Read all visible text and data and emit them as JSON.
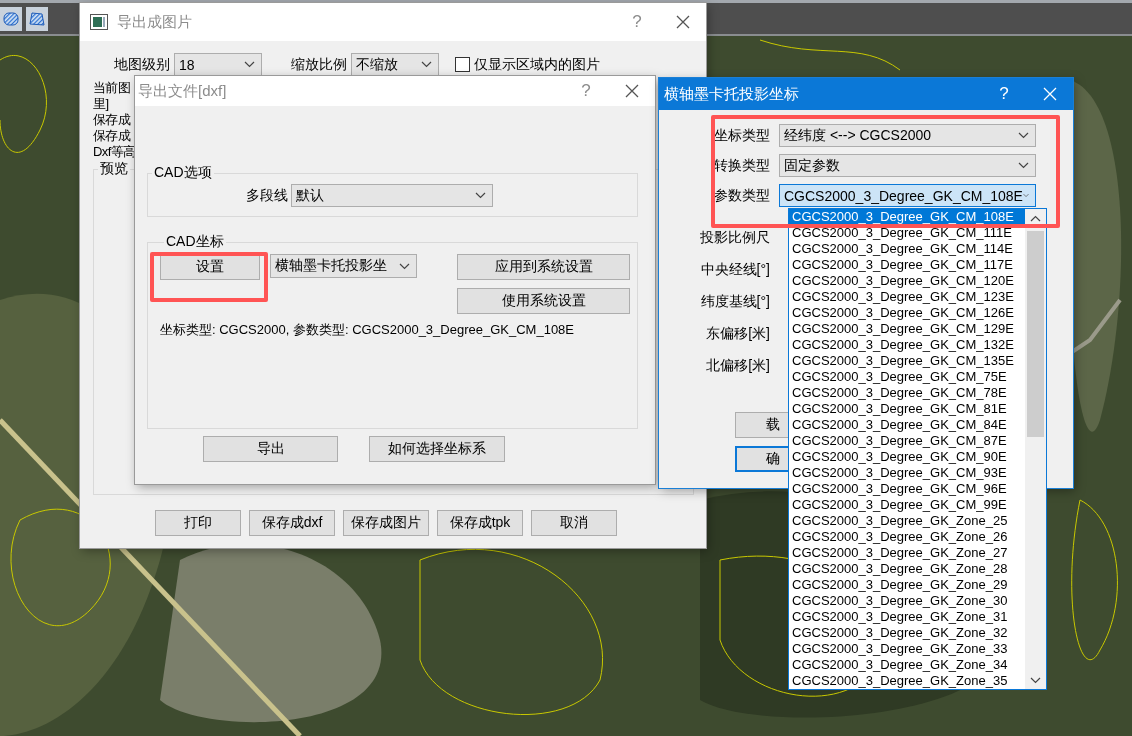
{
  "export_image_dialog": {
    "title": "导出成图片",
    "help": "?",
    "active": false,
    "map_level": {
      "label": "地图级别",
      "value": "18"
    },
    "scale": {
      "label": "缩放比例",
      "value": "不缩放"
    },
    "region_only": {
      "label": "仅显示区域内的图片",
      "checked": false
    },
    "info_lines": [
      "当前图",
      "里]",
      "保存成",
      "保存成",
      "Dxf等高"
    ],
    "preview_group": "预览",
    "buttons": [
      "打印",
      "保存成dxf",
      "保存成图片",
      "保存成tpk",
      "取消"
    ]
  },
  "dxf_dialog": {
    "title": "导出文件[dxf]",
    "help": "?",
    "active": false,
    "cad_options": {
      "title": "CAD选项",
      "polyline": {
        "label": "多段线",
        "value": "默认"
      }
    },
    "cad_coords": {
      "title": "CAD坐标",
      "settings_button": {
        "label": "设置",
        "highlighted": true
      },
      "projection": {
        "value": "横轴墨卡托投影坐"
      },
      "buttons": [
        "应用到系统设置",
        "使用系统设置"
      ],
      "summary": "坐标类型: CGCS2000, 参数类型: CGCS2000_3_Degree_GK_CM_108E"
    },
    "buttons": [
      "导出",
      "如何选择坐标系"
    ]
  },
  "projection_dialog": {
    "title": "横轴墨卡托投影坐标",
    "help": "?",
    "active": true,
    "highlighted": true,
    "fields": [
      {
        "label": "坐标类型",
        "value": "经纬度 <--> CGCS2000",
        "focused": false
      },
      {
        "label": "转换类型",
        "value": "固定参数",
        "focused": false
      },
      {
        "label": "参数类型",
        "value": "CGCS2000_3_Degree_GK_CM_108E",
        "focused": true
      }
    ],
    "labels": [
      "投影比例尺",
      "中央经线[°]",
      "纬度基线[°]",
      "东偏移[米]",
      "北偏移[米]"
    ],
    "buttons": [
      {
        "label": "载",
        "default": false
      },
      {
        "label": "确",
        "default": true
      }
    ],
    "dropdown": [
      {
        "label": "CGCS2000_3_Degree_GK_CM_108E",
        "selected": true
      },
      {
        "label": "CGCS2000_3_Degree_GK_CM_111E",
        "selected": false
      },
      {
        "label": "CGCS2000_3_Degree_GK_CM_114E",
        "selected": false
      },
      {
        "label": "CGCS2000_3_Degree_GK_CM_117E",
        "selected": false
      },
      {
        "label": "CGCS2000_3_Degree_GK_CM_120E",
        "selected": false
      },
      {
        "label": "CGCS2000_3_Degree_GK_CM_123E",
        "selected": false
      },
      {
        "label": "CGCS2000_3_Degree_GK_CM_126E",
        "selected": false
      },
      {
        "label": "CGCS2000_3_Degree_GK_CM_129E",
        "selected": false
      },
      {
        "label": "CGCS2000_3_Degree_GK_CM_132E",
        "selected": false
      },
      {
        "label": "CGCS2000_3_Degree_GK_CM_135E",
        "selected": false
      },
      {
        "label": "CGCS2000_3_Degree_GK_CM_75E",
        "selected": false
      },
      {
        "label": "CGCS2000_3_Degree_GK_CM_78E",
        "selected": false
      },
      {
        "label": "CGCS2000_3_Degree_GK_CM_81E",
        "selected": false
      },
      {
        "label": "CGCS2000_3_Degree_GK_CM_84E",
        "selected": false
      },
      {
        "label": "CGCS2000_3_Degree_GK_CM_87E",
        "selected": false
      },
      {
        "label": "CGCS2000_3_Degree_GK_CM_90E",
        "selected": false
      },
      {
        "label": "CGCS2000_3_Degree_GK_CM_93E",
        "selected": false
      },
      {
        "label": "CGCS2000_3_Degree_GK_CM_96E",
        "selected": false
      },
      {
        "label": "CGCS2000_3_Degree_GK_CM_99E",
        "selected": false
      },
      {
        "label": "CGCS2000_3_Degree_GK_Zone_25",
        "selected": false
      },
      {
        "label": "CGCS2000_3_Degree_GK_Zone_26",
        "selected": false
      },
      {
        "label": "CGCS2000_3_Degree_GK_Zone_27",
        "selected": false
      },
      {
        "label": "CGCS2000_3_Degree_GK_Zone_28",
        "selected": false
      },
      {
        "label": "CGCS2000_3_Degree_GK_Zone_29",
        "selected": false
      },
      {
        "label": "CGCS2000_3_Degree_GK_Zone_30",
        "selected": false
      },
      {
        "label": "CGCS2000_3_Degree_GK_Zone_31",
        "selected": false
      },
      {
        "label": "CGCS2000_3_Degree_GK_Zone_32",
        "selected": false
      },
      {
        "label": "CGCS2000_3_Degree_GK_Zone_33",
        "selected": false
      },
      {
        "label": "CGCS2000_3_Degree_GK_Zone_34",
        "selected": false
      },
      {
        "label": "CGCS2000_3_Degree_GK_Zone_35",
        "selected": false
      }
    ]
  }
}
